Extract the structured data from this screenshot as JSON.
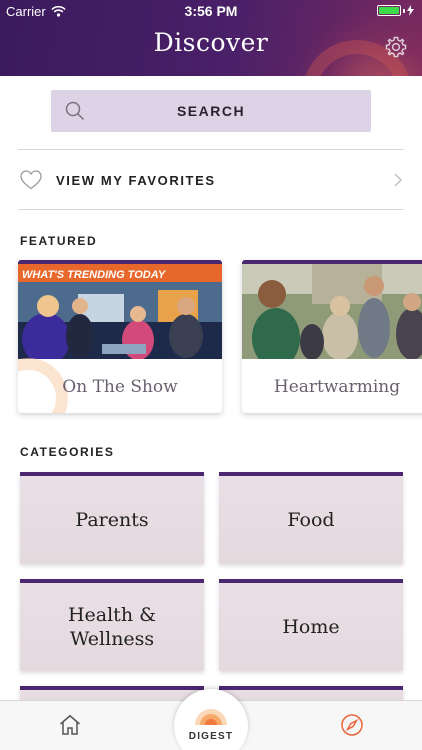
{
  "status_bar": {
    "carrier": "Carrier",
    "time": "3:56 PM"
  },
  "header": {
    "title": "Discover"
  },
  "search": {
    "label": "SEARCH"
  },
  "favorites": {
    "label": "VIEW MY FAVORITES"
  },
  "featured": {
    "heading": "FEATURED",
    "cards": [
      {
        "label": "On The Show",
        "image_banner": "WHAT'S TRENDING TODAY"
      },
      {
        "label": "Heartwarming"
      }
    ]
  },
  "categories": {
    "heading": "CATEGORIES",
    "items": [
      {
        "label": "Parents"
      },
      {
        "label": "Food"
      },
      {
        "label": "Health & Wellness"
      },
      {
        "label": "Home"
      }
    ]
  },
  "tabbar": {
    "digest_label": "DIGEST"
  },
  "colors": {
    "header_purple": "#3a1a5c",
    "accent_purple": "#4b2770",
    "search_bg": "#dcd3e6",
    "tile_bg": "#e6dbe0",
    "compass_orange": "#e8643a"
  },
  "icons": [
    "wifi-icon",
    "battery-icon",
    "gear-icon",
    "search-icon",
    "heart-icon",
    "chevron-right-icon",
    "home-icon",
    "digest-sun-icon",
    "compass-icon"
  ]
}
